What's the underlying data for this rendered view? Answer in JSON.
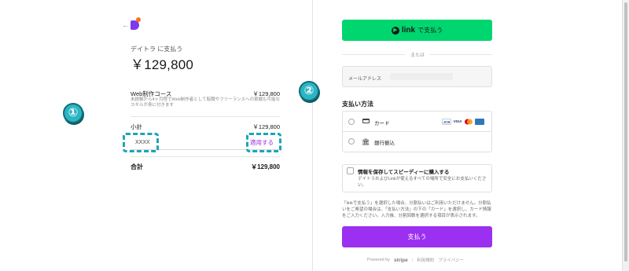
{
  "order": {
    "back_icon": "arrow-left-icon",
    "merchant_label": "デイトラ に支払う",
    "amount": "￥129,800",
    "item": {
      "name": "Web制作コース",
      "price": "￥129,800",
      "description": "未経験から4ヶ月程でWeb制作者として転職やフリーランスへの挑戦も可能なスキルが身に付きます"
    },
    "subtotal": {
      "label": "小計",
      "value": "￥129,800"
    },
    "coupon": {
      "value": "XXXX",
      "apply_label": "適用する"
    },
    "total": {
      "label": "合計",
      "value": "￥129,800"
    }
  },
  "annotations": {
    "marker_1": "①",
    "marker_2": "②"
  },
  "payment": {
    "link_button": {
      "icon": "play-icon",
      "brand": "link",
      "text": "で支払う"
    },
    "or_text": "または",
    "email_label": "メールアドレス",
    "method_title": "支払い方法",
    "methods": [
      {
        "label": "カード",
        "icon": "credit-card-icon",
        "brands": [
          "JCB",
          "VISA",
          "MC",
          "AMEX"
        ]
      },
      {
        "label": "銀行振込",
        "icon": "bank-icon"
      }
    ],
    "save_info": {
      "title": "情報を保存してスピーディーに購入する",
      "description": "デイトラおよびLinkが使えるすべての場所で安全にお支払いください。"
    },
    "notice": "「linkで支払う」を選択した場合、分割払いはご利用いただけません。分割払いをご希望の場合は、「支払い方法」の下の「カード」を選択し、カード情報をご入力ください。入力後、分割回数を選択する項目が表示されます。",
    "pay_button": "支払う",
    "footer": {
      "powered_by": "Powered by",
      "brand": "stripe",
      "terms": "利用規約",
      "privacy": "プライバシー"
    }
  },
  "colors": {
    "link_green": "#00d66f",
    "pay_purple": "#9b30f0",
    "apply_purple": "#9b30d9",
    "annotation_teal": "#1aa6b7"
  }
}
